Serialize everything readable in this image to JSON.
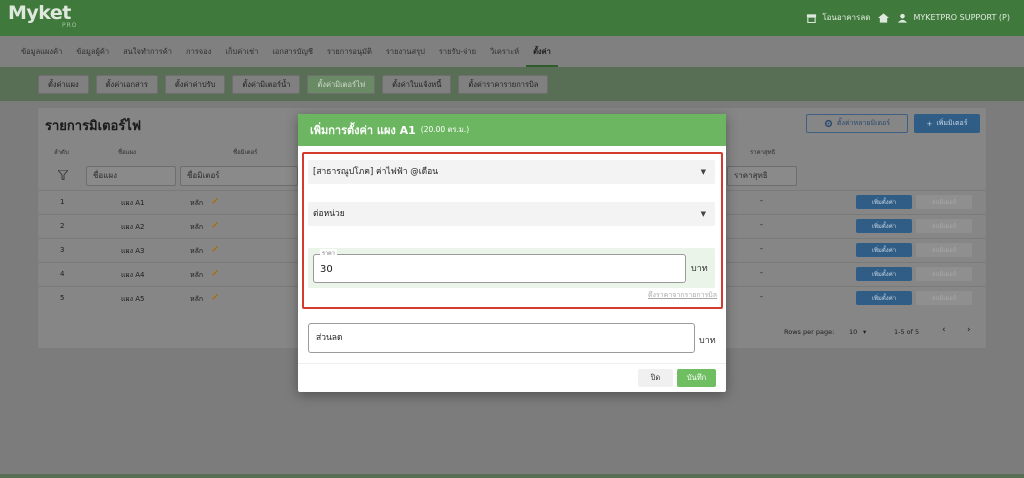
{
  "app": {
    "logo": "Myket",
    "logo_sub": "PRO",
    "store_label": "โอนอาคารลด",
    "user_label": "MYKETPRO SUPPORT (P)"
  },
  "mainnav": [
    {
      "label": "ข้อมูลแผงค้า"
    },
    {
      "label": "ข้อมูลผู้ค้า"
    },
    {
      "label": "สนใจทำการค้า"
    },
    {
      "label": "การจอง"
    },
    {
      "label": "เก็บค่าเช่า"
    },
    {
      "label": "เอกสารบัญชี"
    },
    {
      "label": "รายการอนุมัติ"
    },
    {
      "label": "รายงานสรุป"
    },
    {
      "label": "รายรับ-จ่าย"
    },
    {
      "label": "วิเคราะห์"
    },
    {
      "label": "ตั้งค่า"
    }
  ],
  "subnav": [
    {
      "label": "ตั้งค่าแผง"
    },
    {
      "label": "ตั้งค่าเอกสาร"
    },
    {
      "label": "ตั้งค่าค่าปรับ"
    },
    {
      "label": "ตั้งค่ามิเตอร์น้ำ"
    },
    {
      "label": "ตั้งค่ามิเตอร์ไฟ"
    },
    {
      "label": "ตั้งค่าใบแจ้งหนี้"
    },
    {
      "label": "ตั้งค่าราคารายการบิล"
    }
  ],
  "page": {
    "title": "รายการมิเตอร์ไฟ",
    "btn_multi": "ตั้งค่าหลายมิเตอร์",
    "btn_add_meter": "เพิ่มมิเตอร์",
    "col_no": "ลำดับ",
    "col_stall": "ชื่อแผง",
    "col_meter": "ชื่อมิเตอร์",
    "col_net": "ราคาสุทธิ",
    "filter_stall": "ชื่อแผง",
    "filter_meter": "ชื่อมิเตอร์",
    "filter_net": "ราคาสุทธิ",
    "rows": [
      {
        "no": "1",
        "stall": "แผง A1",
        "meter": "หลัก",
        "net": "-"
      },
      {
        "no": "2",
        "stall": "แผง A2",
        "meter": "หลัก",
        "net": "-"
      },
      {
        "no": "3",
        "stall": "แผง A3",
        "meter": "หลัก",
        "net": "-"
      },
      {
        "no": "4",
        "stall": "แผง A4",
        "meter": "หลัก",
        "net": "-"
      },
      {
        "no": "5",
        "stall": "แผง A5",
        "meter": "หลัก",
        "net": "-"
      }
    ],
    "row_add": "เพิ่มตั้งค่า",
    "row_del": "ลบมิเตอร์",
    "rows_per_page_label": "Rows per page:",
    "rows_per_page": "10",
    "range": "1-5 of 5"
  },
  "modal": {
    "title": "เพิ่มการตั้งค่า แผง A1",
    "subtitle": "(20.00 ตร.ม.)",
    "select_item": "[สาธารณูปโภค] ค่าไฟฟ้า @เดือน",
    "select_unit": "ต่อหน่วย",
    "price_label": "ราคา",
    "price_value": "30",
    "price_unit": "บาท",
    "price_link": "ดึงราคาจากรายการบิล",
    "discount_placeholder": "ส่วนลด",
    "discount_unit": "บาท",
    "btn_close": "ปิด",
    "btn_save": "บันทึก"
  },
  "colors": {
    "header_green": "#6cb661",
    "highlight_red": "#d43b2f",
    "save_green": "#6fbf62"
  }
}
